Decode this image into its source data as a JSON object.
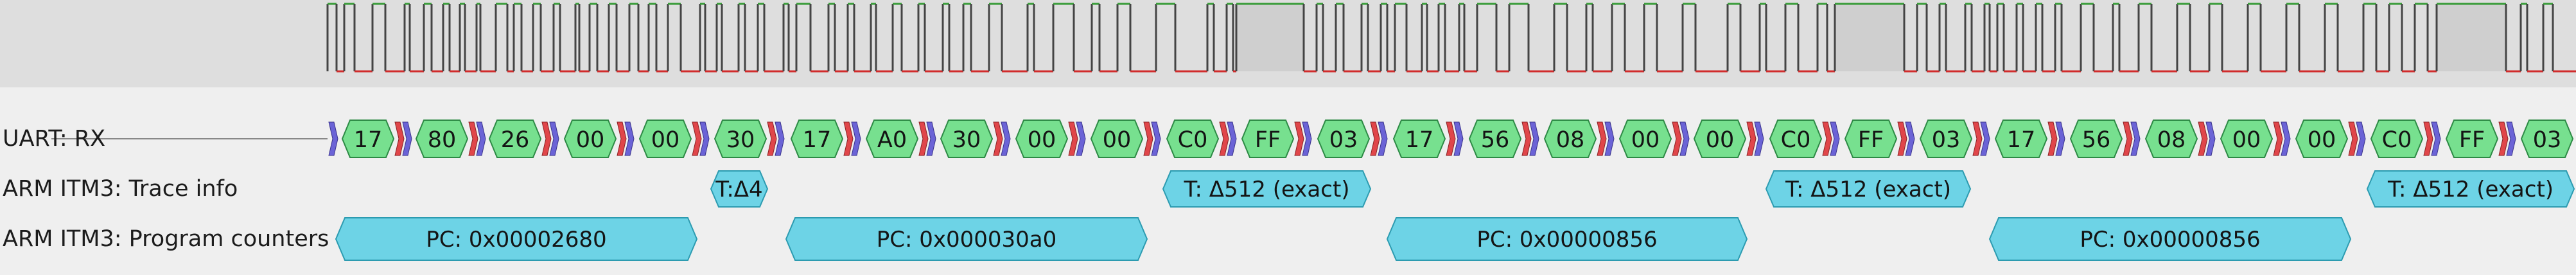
{
  "rows": {
    "uart_rx": "UART: RX",
    "itm_trace_info": "ARM ITM3: Trace info",
    "itm_program_counters": "ARM ITM3: Program counters"
  },
  "uart_bytes": [
    "17",
    "80",
    "26",
    "00",
    "00",
    "30",
    "17",
    "A0",
    "30",
    "00",
    "00",
    "C0",
    "FF",
    "03",
    "17",
    "56",
    "08",
    "00",
    "00",
    "C0",
    "FF",
    "03",
    "17",
    "56",
    "08",
    "00",
    "00",
    "C0",
    "FF",
    "03"
  ],
  "trace_info": [
    "T:Δ4",
    "T: Δ512 (exact)",
    "T: Δ512 (exact)",
    "T: Δ512 (exact)"
  ],
  "program_counters": [
    "PC: 0x00002680",
    "PC: 0x000030a0",
    "PC: 0x00000856",
    "PC: 0x00000856"
  ],
  "colors": {
    "uart_fill": "#77e08f",
    "uart_stroke": "#2d8a45",
    "marker_red": "#e0464a",
    "marker_blue": "#6b63d6",
    "itm_fill": "#6dd3e6",
    "itm_stroke": "#2c9bb0",
    "wave_high": "#3a9c3a",
    "wave_low": "#d12c2c",
    "wave_bg": "#dedede",
    "idle_block": "#cfcfcf"
  }
}
